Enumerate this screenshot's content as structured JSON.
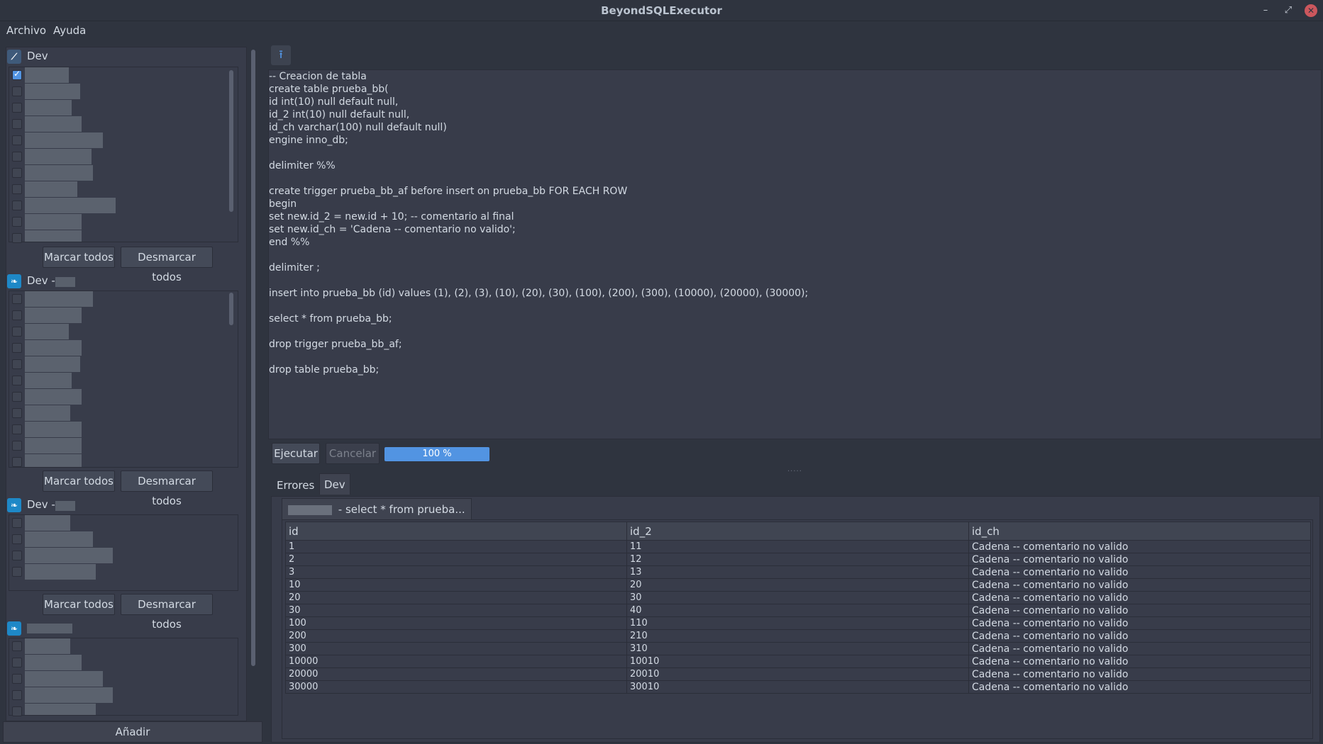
{
  "window": {
    "title": "BeyondSQLExecutor",
    "controls": {
      "minimize": "–",
      "restore": "⤢",
      "close": "✕"
    }
  },
  "menu": {
    "items": [
      "Archivo",
      "Ayuda"
    ]
  },
  "sidebar": {
    "connections": [
      {
        "name": "Dev",
        "icon": "ssh-connection-icon",
        "first_checked": true
      },
      {
        "name": "Dev -",
        "icon": "mysql-connection-icon"
      },
      {
        "name": "Dev -",
        "icon": "mysql-connection-icon"
      },
      {
        "name": "",
        "icon": "mysql-connection-icon"
      }
    ],
    "mark_all_label": "Marcar todos",
    "unmark_all_label": "Desmarcar todos",
    "add_label": "Añadir"
  },
  "toolbar": {
    "upload_icon": "upload-icon"
  },
  "editor": {
    "sql": "-- Creacion de tabla\ncreate table prueba_bb(\nid int(10) null default null,\nid_2 int(10) null default null,\nid_ch varchar(100) null default null)\nengine inno_db;\n\ndelimiter %%\n\ncreate trigger prueba_bb_af before insert on prueba_bb FOR EACH ROW\nbegin\nset new.id_2 = new.id + 10; -- comentario al final\nset new.id_ch = 'Cadena -- comentario no valido';\nend %%\n\ndelimiter ;\n\ninsert into prueba_bb (id) values (1), (2), (3), (10), (20), (30), (100), (200), (300), (10000), (20000), (30000);\n\nselect * from prueba_bb;\n\ndrop trigger prueba_bb_af;\n\ndrop table prueba_bb;"
  },
  "actions": {
    "execute_label": "Ejecutar",
    "cancel_label": "Cancelar",
    "progress_text": "100 %",
    "progress_value": 100
  },
  "tabs": {
    "errors_label": "Errores",
    "dev_label": "Dev"
  },
  "results": {
    "subtab_label": " - select * from prueba...",
    "columns": [
      "id",
      "id_2",
      "id_ch"
    ],
    "rows": [
      [
        "1",
        "11",
        "Cadena -- comentario no valido"
      ],
      [
        "2",
        "12",
        "Cadena -- comentario no valido"
      ],
      [
        "3",
        "13",
        "Cadena -- comentario no valido"
      ],
      [
        "10",
        "20",
        "Cadena -- comentario no valido"
      ],
      [
        "20",
        "30",
        "Cadena -- comentario no valido"
      ],
      [
        "30",
        "40",
        "Cadena -- comentario no valido"
      ],
      [
        "100",
        "110",
        "Cadena -- comentario no valido"
      ],
      [
        "200",
        "210",
        "Cadena -- comentario no valido"
      ],
      [
        "300",
        "310",
        "Cadena -- comentario no valido"
      ],
      [
        "10000",
        "10010",
        "Cadena -- comentario no valido"
      ],
      [
        "20000",
        "20010",
        "Cadena -- comentario no valido"
      ],
      [
        "30000",
        "30010",
        "Cadena -- comentario no valido"
      ]
    ]
  },
  "colors": {
    "accent": "#5294e2",
    "close": "#cc575d",
    "background": "#2f343f",
    "panel": "#383c4a"
  }
}
